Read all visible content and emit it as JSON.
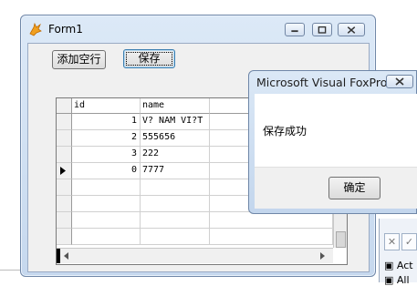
{
  "form1": {
    "title": "Form1",
    "buttons": {
      "add_row": "添加空行",
      "save": "保存"
    }
  },
  "grid": {
    "columns": [
      "id",
      "name"
    ],
    "rows": [
      {
        "id": "1",
        "name": "V? NAM VI?T"
      },
      {
        "id": "2",
        "name": "555656"
      },
      {
        "id": "3",
        "name": "222"
      },
      {
        "id": "0",
        "name": "7777"
      }
    ],
    "current_row_index": 3
  },
  "messagebox": {
    "title": "Microsoft Visual FoxPro",
    "message": "保存成功",
    "ok": "确定"
  },
  "background_panel": {
    "items": [
      "Act",
      "All"
    ]
  },
  "colors": {
    "title_bar": "#c6d8ee",
    "frame_border": "#6f87a8",
    "client": "#f0f0f0"
  }
}
